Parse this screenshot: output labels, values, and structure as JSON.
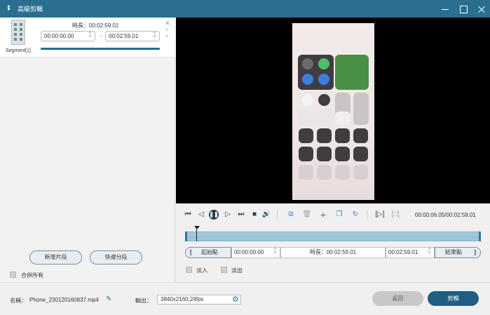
{
  "window": {
    "title": "高級剪輯",
    "logo_glyph": "ꔪ"
  },
  "segment": {
    "label": "Segment[1]",
    "duration_text": "時長：00:02:59.01",
    "start_time": "00:00:00.00",
    "end_time": "00:02:59.01",
    "dash": "–"
  },
  "left_actions": {
    "add_segment": "新增片段",
    "fast_split": "快速分段",
    "merge_all": "合併所有"
  },
  "player": {
    "time_readout": "00:00:06.05/00:02:59.01",
    "icons": [
      "skip-start-icon",
      "step-back-icon",
      "pause-icon",
      "step-forward-icon",
      "skip-end-icon",
      "stop-icon",
      "volume-icon",
      "split-icon",
      "delete-icon",
      "add-icon",
      "copy-icon",
      "reset-icon",
      "mark-in-icon",
      "mark-out-icon"
    ]
  },
  "trim": {
    "start_label": "起始點",
    "start_value": "00:00:00.00",
    "duration_text": "時長：00:02:59.01",
    "end_value": "00:02:59.01",
    "end_label": "結束點",
    "fade_in": "淡入",
    "fade_out": "淡出"
  },
  "footer": {
    "name_label": "名稱：",
    "file_name": "Phone_230120160837.mp4",
    "output_label": "輸出：",
    "output_value": "3840x2160;24fps",
    "back_button": "返回",
    "clip_button": "剪輯"
  },
  "colors": {
    "titlebar": "#2a6f8f",
    "accent": "#1f6e94",
    "timeline": "#9ec7dc"
  }
}
